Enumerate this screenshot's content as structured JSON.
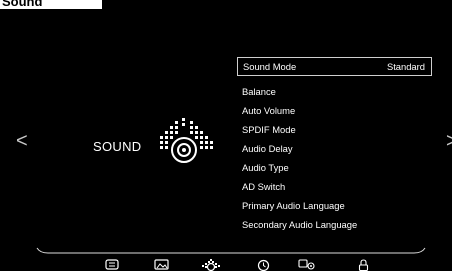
{
  "page": {
    "caption": "Sound"
  },
  "category": {
    "title": "SOUND"
  },
  "menu": {
    "selected": {
      "label": "Sound Mode",
      "value": "Standard"
    },
    "items": [
      {
        "label": "Balance"
      },
      {
        "label": "Auto Volume"
      },
      {
        "label": "SPDIF Mode"
      },
      {
        "label": "Audio Delay"
      },
      {
        "label": "Audio Type"
      },
      {
        "label": "AD Switch"
      },
      {
        "label": "Primary Audio Language"
      },
      {
        "label": "Secondary Audio Language"
      }
    ]
  },
  "navigation": {
    "left": "<",
    "right": ">"
  },
  "bottom_bar": {
    "icons": [
      {
        "name": "channel-icon"
      },
      {
        "name": "picture-icon"
      },
      {
        "name": "sound-icon",
        "active": true
      },
      {
        "name": "time-icon"
      },
      {
        "name": "setup-icon"
      },
      {
        "name": "lock-icon"
      }
    ]
  },
  "colors": {
    "background": "#000000",
    "text": "#ffffff",
    "accent": "#cfcfcf"
  }
}
